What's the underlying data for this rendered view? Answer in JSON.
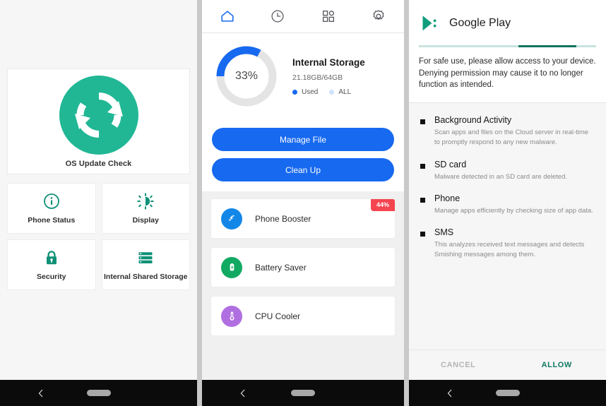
{
  "colors": {
    "teal": "#1fb795",
    "blue": "#1769f0",
    "red_badge": "#f4444f",
    "green": "#12aa62",
    "purple": "#b06fe0",
    "play_teal": "#0f9d7c",
    "allow_teal": "#0f7a63"
  },
  "panel_left": {
    "hero": {
      "icon": "refresh-sync-icon",
      "label": "OS Update Check"
    },
    "tiles": [
      {
        "icon": "info-circle-icon",
        "label": "Phone Status"
      },
      {
        "icon": "brightness-icon",
        "label": "Display"
      },
      {
        "icon": "lock-icon",
        "label": "Security"
      },
      {
        "icon": "storage-list-icon",
        "label": "Internal Shared Storage"
      }
    ],
    "navbar": {
      "back": "back-chevron-icon",
      "home": "home-pill-indicator"
    }
  },
  "panel_middle": {
    "tabs": [
      {
        "icon": "home-icon",
        "name": "tab-home",
        "active": true
      },
      {
        "icon": "clock-icon",
        "name": "tab-history",
        "active": false
      },
      {
        "icon": "apps-grid-icon",
        "name": "tab-apps",
        "active": false
      },
      {
        "icon": "gear-icon",
        "name": "tab-settings",
        "active": false
      }
    ],
    "storage": {
      "percent_label": "33%",
      "percent_value": 33,
      "title": "Internal Storage",
      "sub": "21.18GB/64GB",
      "legend": [
        {
          "label": "Used",
          "color": "#1769f0"
        },
        {
          "label": "ALL",
          "color": "#cfe3fb"
        }
      ]
    },
    "buttons": [
      {
        "label": "Manage File",
        "name": "manage-file-button"
      },
      {
        "label": "Clean Up",
        "name": "clean-up-button"
      }
    ],
    "tools": [
      {
        "label": "Phone Booster",
        "icon": "rocket-icon",
        "color": "#1287e8",
        "badge": "44%"
      },
      {
        "label": "Battery Saver",
        "icon": "battery-icon",
        "color": "#12aa62",
        "badge": ""
      },
      {
        "label": "CPU Cooler",
        "icon": "thermometer-icon",
        "color": "#b06fe0",
        "badge": ""
      }
    ],
    "navbar": {
      "back": "back-chevron-icon",
      "home": "home-pill-indicator"
    }
  },
  "panel_right": {
    "header": {
      "icon": "google-play-icon",
      "title": "Google Play",
      "progress_percent": 33
    },
    "description": "For safe use, please allow access to your device.\nDenying permission may cause it to no longer function as intended.",
    "permissions": [
      {
        "title": "Background Activity",
        "desc": "Scan apps and files on the Cloud server in real-time to promptly respond to any new malware."
      },
      {
        "title": "SD card",
        "desc": "Malware detected in an SD card are deleted."
      },
      {
        "title": "Phone",
        "desc": "Manage apps efficiently by checking size of app data."
      },
      {
        "title": "SMS",
        "desc": "This analyzes received text messages and detects Smishing messages among them."
      }
    ],
    "actions": {
      "cancel": "CANCEL",
      "allow": "ALLOW"
    },
    "navbar": {
      "back": "back-chevron-icon",
      "home": "home-pill-indicator"
    }
  }
}
